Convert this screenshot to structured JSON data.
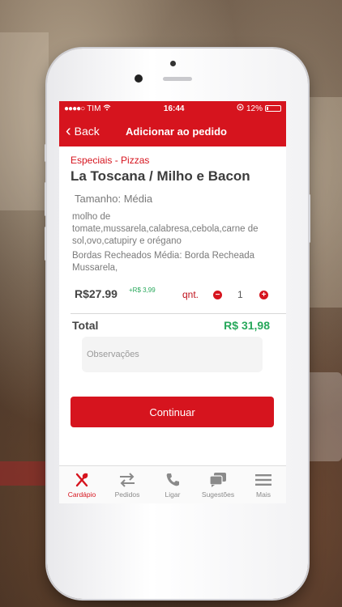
{
  "status_bar": {
    "carrier": "TIM",
    "time": "16:44",
    "battery": "12%"
  },
  "nav": {
    "back_label": "Back",
    "title": "Adicionar ao pedido"
  },
  "product": {
    "category": "Especiais - Pizzas",
    "name": "La Toscana / Milho e Bacon",
    "size": "Tamanho: Média",
    "ingredients": "molho de tomate,mussarela,calabresa,cebola,carne de sol,ovo,catupiry e orégano",
    "border": "Bordas Recheados Média: Borda Recheada Mussarela,",
    "price": "R$27.99",
    "extra": "+R$ 3,99",
    "qnt_label": "qnt.",
    "quantity": "1",
    "minus_symbol": "−",
    "plus_symbol": "+"
  },
  "total": {
    "label": "Total",
    "value": "R$ 31,98"
  },
  "observations": {
    "placeholder": "Observações"
  },
  "continue_label": "Continuar",
  "tabs": [
    {
      "label": "Cardápio",
      "icon": "utensils-icon",
      "active": true
    },
    {
      "label": "Pedidos",
      "icon": "swap-arrows-icon",
      "active": false
    },
    {
      "label": "Ligar",
      "icon": "phone-icon",
      "active": false
    },
    {
      "label": "Sugestões",
      "icon": "chat-bubbles-icon",
      "active": false
    },
    {
      "label": "Mais",
      "icon": "menu-icon",
      "active": false
    }
  ],
  "colors": {
    "brand_red": "#d6141e",
    "price_green": "#27a85b"
  }
}
